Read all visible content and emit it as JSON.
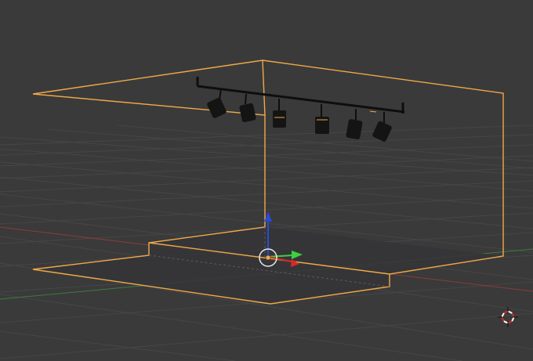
{
  "viewport": {
    "background": "#3a3a3a",
    "grid_color": "#474747",
    "selection_color": "#f0a848",
    "x_axis_color": "#8a3a3a",
    "y_axis_color": "#3f7a3f",
    "gizmo_z_color": "#2a4bd4",
    "gizmo_y_color": "#3fcf3f",
    "gizmo_x_color": "#d42a2a"
  },
  "objects": {
    "stage": {
      "name": "selected-stage-mesh",
      "selected": true
    },
    "light_rail": {
      "name": "track-light-rail"
    },
    "spotlights": [
      "spotlight-1",
      "spotlight-2",
      "spotlight-3",
      "spotlight-4",
      "spotlight-5",
      "spotlight-6"
    ]
  },
  "icons": {
    "origin": "object-origin-icon",
    "cursor": "3d-cursor-icon",
    "gizmo": "transform-gizmo-icon"
  }
}
